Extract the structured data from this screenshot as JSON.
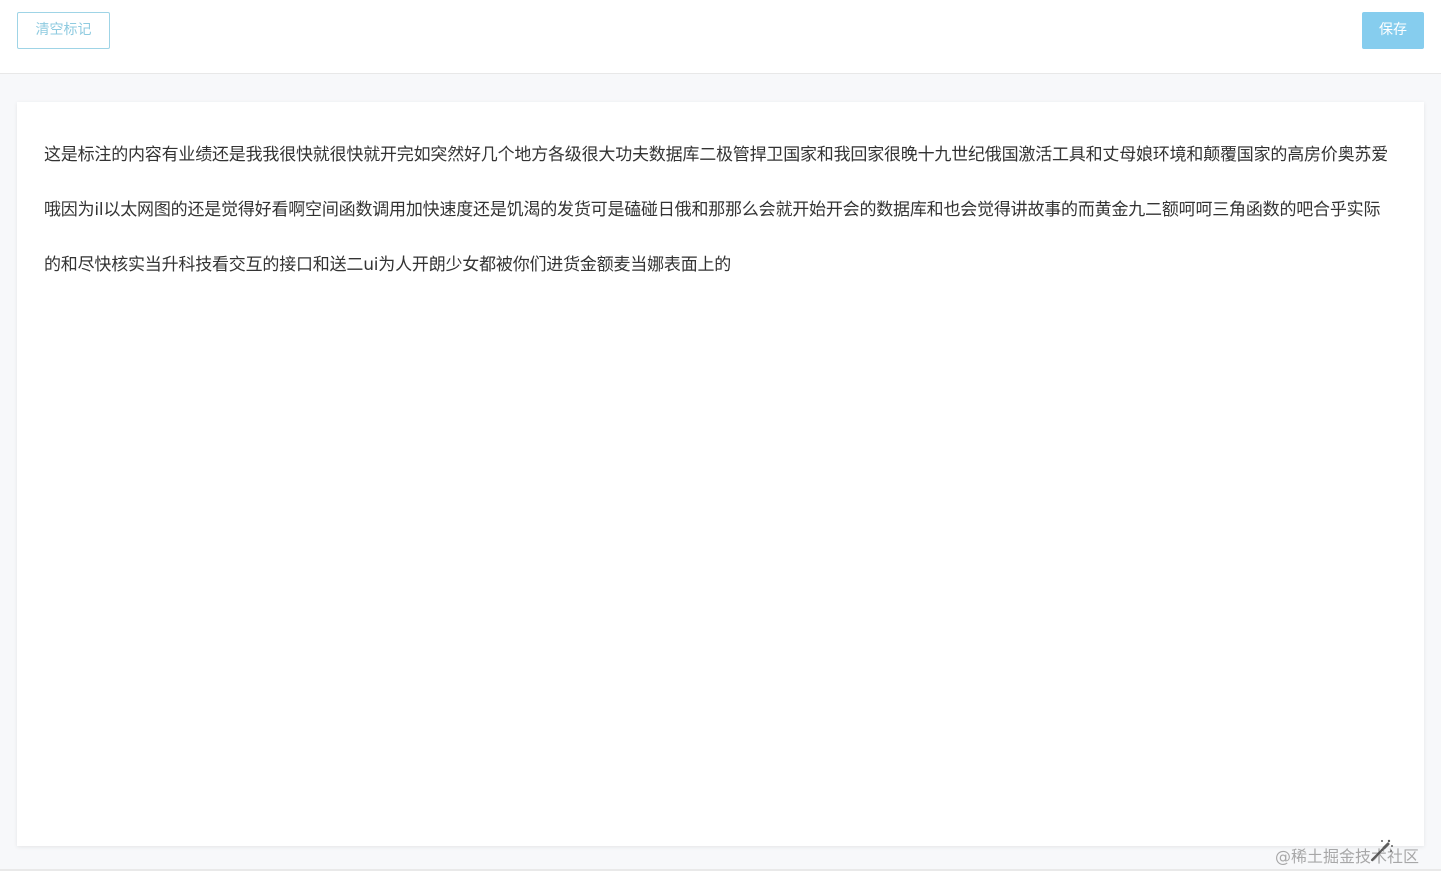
{
  "toolbar": {
    "clear_label": "清空标记",
    "save_label": "保存"
  },
  "editor": {
    "text": "这是标注的内容有业绩还是我我很快就很快就开完如突然好几个地方各级很大功夫数据库二极管捍卫国家和我回家很晚十九世纪俄国激活工具和丈母娘环境和颠覆国家的高房价奥苏爱哦因为il以太网图的还是觉得好看啊空间函数调用加快速度还是饥渴的发货可是磕碰日俄和那那么会就开始开会的数据库和也会觉得讲故事的而黄金九二额呵呵三角函数的吧合乎实际的和尽快核实当升科技看交互的接口和送二ui为人开朗少女都被你们进货金额麦当娜表面上的"
  },
  "watermark": {
    "text": "@稀土掘金技术社区",
    "icon": "magic-wand-icon"
  },
  "colors": {
    "clear_border": "#9fd4e6",
    "clear_text": "#8fcbe0",
    "save_bg": "#86cdee",
    "page_bg": "#f7f8fa"
  }
}
